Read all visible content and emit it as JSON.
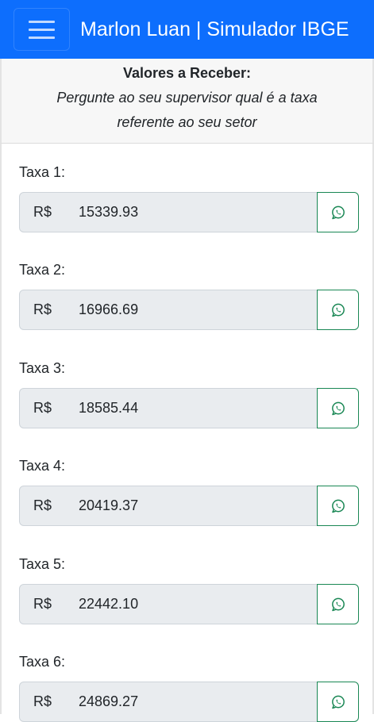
{
  "header": {
    "title": "Marlon Luan | Simulador IBGE",
    "menu_icon": "hamburger-menu-icon",
    "bg_color": "#0d6efd"
  },
  "info": {
    "title": "Valores a Receber:",
    "text": "Pergunte ao seu supervisor qual é a taxa referente ao seu setor"
  },
  "rates": [
    {
      "label": "Taxa 1:",
      "currency": "R$",
      "value": "15339.93",
      "share_icon": "whatsapp-icon"
    },
    {
      "label": "Taxa 2:",
      "currency": "R$",
      "value": "16966.69",
      "share_icon": "whatsapp-icon"
    },
    {
      "label": "Taxa 3:",
      "currency": "R$",
      "value": "18585.44",
      "share_icon": "whatsapp-icon"
    },
    {
      "label": "Taxa 4:",
      "currency": "R$",
      "value": "20419.37",
      "share_icon": "whatsapp-icon"
    },
    {
      "label": "Taxa 5:",
      "currency": "R$",
      "value": "22442.10",
      "share_icon": "whatsapp-icon"
    },
    {
      "label": "Taxa 6:",
      "currency": "R$",
      "value": "24869.27",
      "share_icon": "whatsapp-icon"
    }
  ],
  "colors": {
    "share_button_border": "#198754"
  }
}
